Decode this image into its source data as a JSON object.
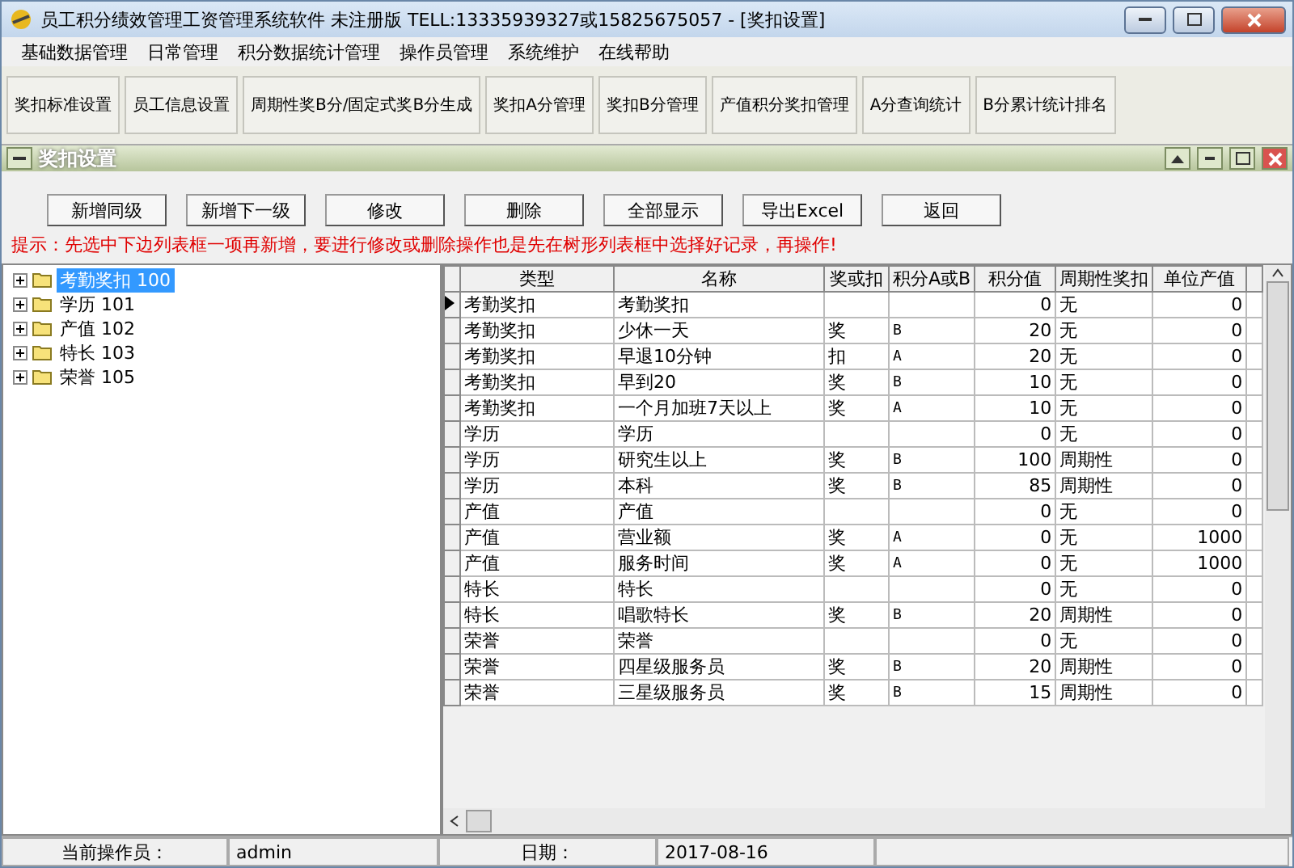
{
  "window": {
    "title": "员工积分绩效管理工资管理系统软件 未注册版 TELL:13335939327或15825675057 - [奖扣设置]"
  },
  "menu": [
    "基础数据管理",
    "日常管理",
    "积分数据统计管理",
    "操作员管理",
    "系统维护",
    "在线帮助"
  ],
  "toolbar": [
    "奖扣标准设置",
    "员工信息设置",
    "周期性奖B分/固定式奖B分生成",
    "奖扣A分管理",
    "奖扣B分管理",
    "产值积分奖扣管理",
    "A分查询统计",
    "B分累计统计排名"
  ],
  "child_window": {
    "title": "奖扣设置"
  },
  "actions": [
    "新增同级",
    "新增下一级",
    "修改",
    "删除",
    "全部显示",
    "导出Excel",
    "返回"
  ],
  "hint": "提示：先选中下边列表框一项再新增，要进行修改或删除操作也是先在树形列表框中选择好记录，再操作!",
  "tree": {
    "items": [
      {
        "label": "考勤奖扣 100",
        "selected": true,
        "expanded": false
      },
      {
        "label": "学历 101",
        "selected": false,
        "expanded": false
      },
      {
        "label": "产值 102",
        "selected": false,
        "expanded": false
      },
      {
        "label": "特长 103",
        "selected": false,
        "expanded": false
      },
      {
        "label": "荣誉 105",
        "selected": false,
        "expanded": false
      }
    ]
  },
  "table": {
    "columns": [
      "类型",
      "名称",
      "奖或扣",
      "积分A或B",
      "积分值",
      "周期性奖扣",
      "单位产值"
    ],
    "rows": [
      {
        "current": true,
        "cells": [
          "考勤奖扣",
          "考勤奖扣",
          "",
          "",
          "0",
          "无",
          "0"
        ]
      },
      {
        "current": false,
        "cells": [
          "考勤奖扣",
          "少休一天",
          "奖",
          "B",
          "20",
          "无",
          "0"
        ]
      },
      {
        "current": false,
        "cells": [
          "考勤奖扣",
          "早退10分钟",
          "扣",
          "A",
          "20",
          "无",
          "0"
        ]
      },
      {
        "current": false,
        "cells": [
          "考勤奖扣",
          "早到20",
          "奖",
          "B",
          "10",
          "无",
          "0"
        ]
      },
      {
        "current": false,
        "cells": [
          "考勤奖扣",
          "一个月加班7天以上",
          "奖",
          "A",
          "10",
          "无",
          "0"
        ]
      },
      {
        "current": false,
        "cells": [
          "学历",
          "学历",
          "",
          "",
          "0",
          "无",
          "0"
        ]
      },
      {
        "current": false,
        "cells": [
          "学历",
          "研究生以上",
          "奖",
          "B",
          "100",
          "周期性",
          "0"
        ]
      },
      {
        "current": false,
        "cells": [
          "学历",
          "本科",
          "奖",
          "B",
          "85",
          "周期性",
          "0"
        ]
      },
      {
        "current": false,
        "cells": [
          "产值",
          "产值",
          "",
          "",
          "0",
          "无",
          "0"
        ]
      },
      {
        "current": false,
        "cells": [
          "产值",
          "营业额",
          "奖",
          "A",
          "0",
          "无",
          "1000"
        ]
      },
      {
        "current": false,
        "cells": [
          "产值",
          "服务时间",
          "奖",
          "A",
          "0",
          "无",
          "1000"
        ]
      },
      {
        "current": false,
        "cells": [
          "特长",
          "特长",
          "",
          "",
          "0",
          "无",
          "0"
        ]
      },
      {
        "current": false,
        "cells": [
          "特长",
          "唱歌特长",
          "奖",
          "B",
          "20",
          "周期性",
          "0"
        ]
      },
      {
        "current": false,
        "cells": [
          "荣誉",
          "荣誉",
          "",
          "",
          "0",
          "无",
          "0"
        ]
      },
      {
        "current": false,
        "cells": [
          "荣誉",
          "四星级服务员",
          "奖",
          "B",
          "20",
          "周期性",
          "0"
        ]
      },
      {
        "current": false,
        "cells": [
          "荣誉",
          "三星级服务员",
          "奖",
          "B",
          "15",
          "周期性",
          "0"
        ]
      }
    ]
  },
  "status_bar": [
    "当前操作员：",
    "admin",
    "日期：",
    "2017-08-16"
  ]
}
